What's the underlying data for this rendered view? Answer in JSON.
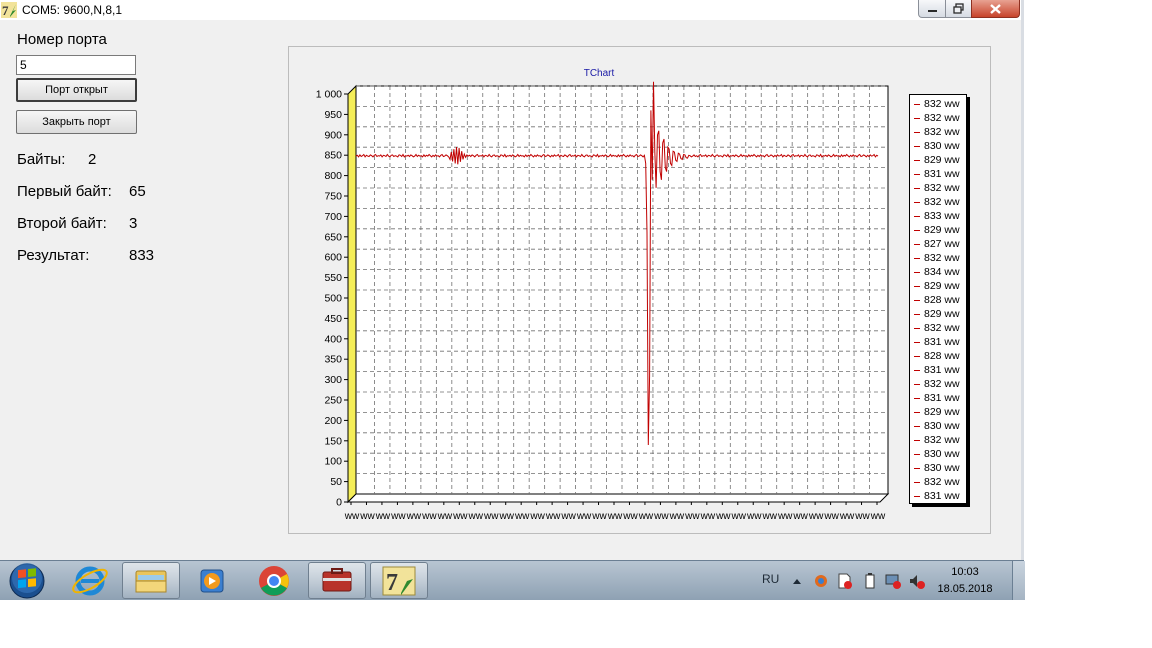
{
  "window": {
    "title": "COM5: 9600,N,8,1"
  },
  "form": {
    "port_label": "Номер порта",
    "port_value": "5",
    "open_button": "Порт открыт",
    "close_button": "Закрыть порт",
    "bytes_label": "Байты:",
    "bytes_value": "2",
    "first_byte_label": "Первый байт:",
    "first_byte_value": "65",
    "second_byte_label": "Второй байт:",
    "second_byte_value": "3",
    "result_label": "Результат:",
    "result_value": "833"
  },
  "chart_data": {
    "type": "line",
    "title": "TChart",
    "ylim": [
      0,
      1000
    ],
    "y_ticks": [
      "0",
      "50",
      "100",
      "150",
      "200",
      "250",
      "300",
      "350",
      "400",
      "450",
      "500",
      "550",
      "600",
      "650",
      "700",
      "750",
      "800",
      "850",
      "900",
      "950",
      "1 000"
    ],
    "x_tick_label": "ww",
    "x_tick_count": 35,
    "grid": true,
    "legend_position": "right",
    "series": [
      {
        "color": "#c00000",
        "values": [
          838,
          840,
          836,
          841,
          837,
          839,
          842,
          836,
          840,
          838,
          837,
          841,
          839,
          836,
          840,
          842,
          837,
          839,
          838,
          841,
          836,
          840,
          839,
          837,
          842,
          838,
          836,
          840,
          841,
          837,
          839,
          838,
          836,
          841,
          840,
          837,
          842,
          836,
          839,
          838,
          840,
          837,
          841,
          839,
          836,
          838,
          842,
          837,
          840,
          838,
          839,
          836,
          841,
          837,
          840,
          838,
          842,
          839,
          836,
          840,
          837,
          841,
          838,
          839,
          836,
          840,
          842,
          837,
          838,
          841,
          839,
          836,
          830,
          848,
          825,
          855,
          820,
          860,
          818,
          858,
          824,
          850,
          830,
          843,
          835,
          841,
          838,
          840,
          837,
          841,
          839,
          836,
          840,
          842,
          837,
          839,
          838,
          841,
          836,
          840,
          839,
          837,
          842,
          838,
          836,
          840,
          841,
          837,
          839,
          838,
          836,
          841,
          840,
          837,
          842,
          836,
          839,
          838,
          840,
          837,
          841,
          839,
          836,
          838,
          842,
          837,
          840,
          838,
          839,
          836,
          841,
          837,
          840,
          838,
          842,
          839,
          836,
          840,
          837,
          841,
          838,
          839,
          836,
          840,
          842,
          837,
          838,
          841,
          839,
          836,
          840,
          837,
          841,
          838,
          839,
          842,
          836,
          840,
          838,
          837,
          841,
          839,
          836,
          840,
          842,
          837,
          839,
          838,
          841,
          836,
          840,
          839,
          837,
          842,
          838,
          836,
          840,
          841,
          837,
          839,
          838,
          836,
          841,
          840,
          837,
          842,
          836,
          839,
          838,
          840,
          837,
          841,
          839,
          836,
          838,
          842,
          837,
          840,
          838,
          839,
          836,
          841,
          837,
          840,
          838,
          842,
          839,
          836,
          840,
          837,
          841,
          838,
          839,
          836,
          840,
          842,
          837,
          838,
          841,
          839,
          836,
          840,
          820,
          650,
          130,
          300,
          950,
          780,
          1020,
          850,
          760,
          890,
          900,
          800,
          780,
          870,
          880,
          810,
          800,
          860,
          855,
          820,
          815,
          850,
          848,
          828,
          825,
          845,
          843,
          832,
          830,
          842,
          841,
          834,
          833,
          840,
          839,
          836,
          838,
          841,
          837,
          839,
          836,
          840,
          842,
          837,
          839,
          838,
          841,
          836,
          840,
          839,
          837,
          842,
          838,
          836,
          840,
          841,
          837,
          839,
          838,
          836,
          841,
          840,
          837,
          842,
          836,
          839,
          838,
          840,
          837,
          841,
          839,
          836,
          838,
          842,
          837,
          840,
          838,
          839,
          836,
          841,
          837,
          840,
          838,
          842,
          839,
          836,
          840,
          837,
          841,
          838,
          839,
          836,
          840,
          842,
          837,
          838,
          841,
          839,
          836,
          840,
          837,
          841,
          838,
          839,
          842,
          836,
          840,
          838,
          837,
          841,
          839,
          836,
          840,
          842,
          837,
          839,
          838,
          841,
          836,
          840,
          839,
          837,
          842,
          838,
          836,
          840,
          841,
          837,
          839,
          838,
          836,
          841,
          840,
          837,
          842,
          836,
          839,
          838,
          840,
          837,
          841,
          839,
          836,
          838,
          842,
          837,
          840,
          838,
          839,
          836,
          841,
          837,
          840,
          838,
          842,
          839,
          836,
          840,
          837,
          841,
          838,
          839,
          836,
          840,
          842,
          837,
          838,
          841,
          839,
          836,
          840,
          837,
          841,
          838,
          839,
          842,
          836,
          840,
          838
        ]
      }
    ],
    "legend": [
      "832 ww",
      "832 ww",
      "832 ww",
      "830 ww",
      "829 ww",
      "831 ww",
      "832 ww",
      "832 ww",
      "833 ww",
      "829 ww",
      "827 ww",
      "832 ww",
      "834 ww",
      "829 ww",
      "828 ww",
      "829 ww",
      "832 ww",
      "831 ww",
      "828 ww",
      "831 ww",
      "832 ww",
      "831 ww",
      "829 ww",
      "830 ww",
      "832 ww",
      "830 ww",
      "830 ww",
      "832 ww",
      "831 ww"
    ]
  },
  "colors": {
    "series": "#c00000",
    "chart_title": "#1a1aa6",
    "wall": "#f5ee58"
  },
  "taskbar": {
    "items": [
      {
        "name": "start-orb-icon"
      },
      {
        "name": "internet-explorer-icon"
      },
      {
        "name": "file-explorer-icon"
      },
      {
        "name": "media-player-icon"
      },
      {
        "name": "chrome-icon"
      },
      {
        "name": "toolbox-app-icon"
      },
      {
        "name": "delphi-app-icon"
      }
    ],
    "language": "RU",
    "time": "10:03",
    "date": "18.05.2018"
  }
}
